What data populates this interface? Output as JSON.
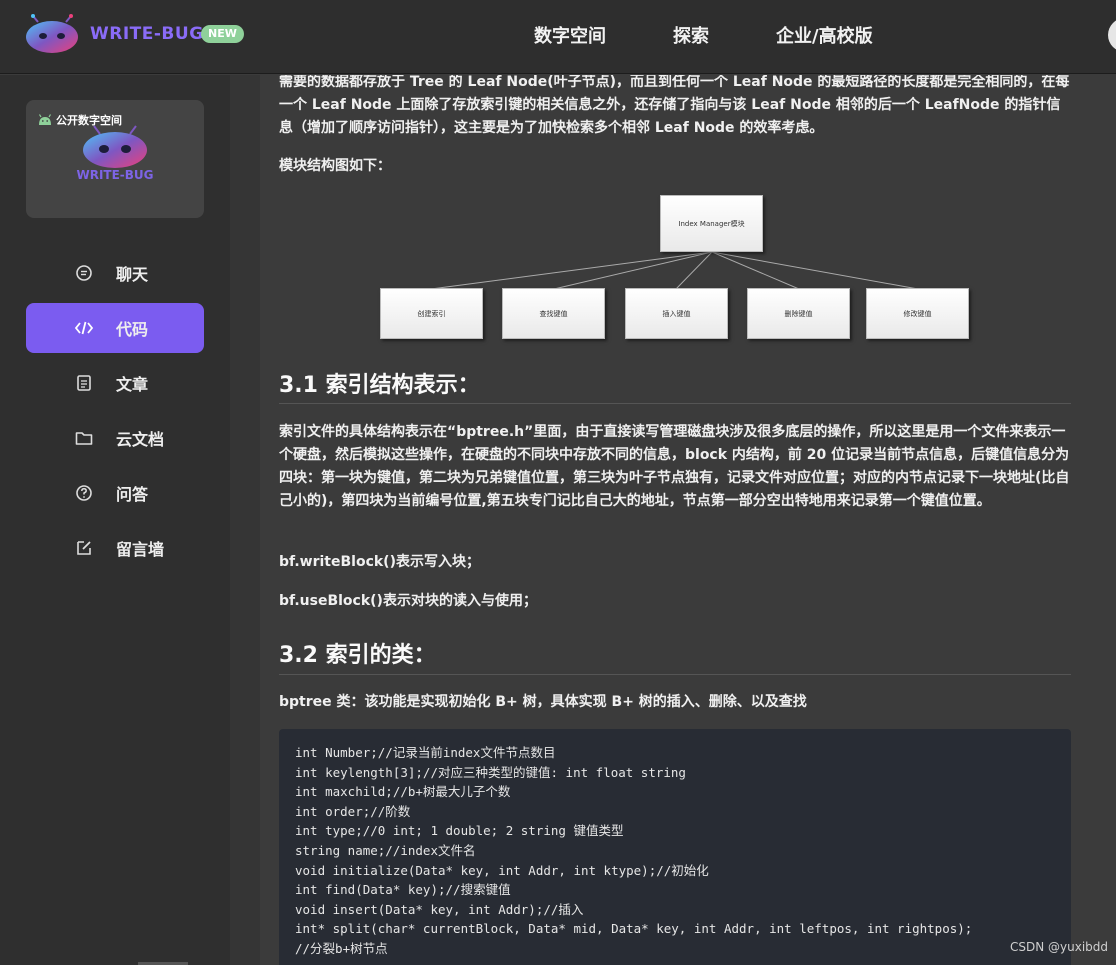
{
  "header": {
    "brand": "WRITE-BUG",
    "badge": "NEW",
    "nav": [
      "数字空间",
      "探索",
      "企业/高校版"
    ]
  },
  "sidebar": {
    "space_card": {
      "label": "公开数字空间",
      "name": "WRITE-BUG"
    },
    "items": [
      {
        "label": "聊天",
        "icon": "chat-icon"
      },
      {
        "label": "代码",
        "icon": "code-icon",
        "active": true
      },
      {
        "label": "文章",
        "icon": "article-icon"
      },
      {
        "label": "云文档",
        "icon": "folder-icon"
      },
      {
        "label": "问答",
        "icon": "question-icon"
      },
      {
        "label": "留言墙",
        "icon": "edit-icon"
      }
    ]
  },
  "content": {
    "intro": "需要的数据都存放于 Tree 的 Leaf Node(叶子节点)，而且到任何一个 Leaf Node 的最短路径的长度都是完全相同的，在每一个 Leaf Node 上面除了存放索引键的相关信息之外，还存储了指向与该 Leaf Node 相邻的后一个 LeafNode 的指针信息（增加了顺序访问指针），这主要是为了加快检索多个相邻 Leaf Node 的效率考虑。",
    "diagram_caption": "模块结构图如下：",
    "diagram": {
      "root": "Index Manager模块",
      "children": [
        "创建索引",
        "查找键值",
        "插入键值",
        "删除键值",
        "修改键值"
      ]
    },
    "section1_title": "3.1 索引结构表示：",
    "section1_body": " 索引文件的具体结构表示在“bptree.h”里面，由于直接读写管理磁盘块涉及很多底层的操作，所以这里是用一个文件来表示一个硬盘，然后模拟这些操作，在硬盘的不同块中存放不同的信息，block 内结构，前 20 位记录当前节点信息，后键值信息分为四块：第一块为键值，第二块为兄弟键值位置，第三块为叶子节点独有，记录文件对应位置；对应的内节点记录下一块地址(比自己小的)，第四块为当前编号位置,第五块专门记比自己大的地址，节点第一部分空出特地用来记录第一个键值位置。",
    "write_block": "bf.writeBlock()表示写入块；",
    "use_block": "bf.useBlock()表示对块的读入与使用；",
    "section2_title": "3.2 索引的类：",
    "section2_body": "bptree 类：该功能是实现初始化 B+ 树，具体实现 B+ 树的插入、删除、以及查找",
    "code_lines": [
      "int Number;//记录当前index文件节点数目",
      "int keylength[3];//对应三种类型的键值: int float string",
      "int maxchild;//b+树最大儿子个数",
      "int order;//阶数",
      "int type;//0 int; 1 double; 2 string 键值类型",
      "string name;//index文件名",
      "void initialize(Data* key, int Addr, int ktype);//初始化",
      "int find(Data* key);//搜索键值",
      "void insert(Data* key, int Addr);//插入",
      "int* split(char* currentBlock, Data* mid, Data* key, int Addr, int leftpos, int rightpos);",
      "//分裂b+树节点"
    ]
  },
  "watermark": "CSDN @yuxibdd",
  "colors": {
    "accent": "#7b5cf0",
    "badge": "#8fd19a",
    "brand": "#8a6cf7"
  }
}
